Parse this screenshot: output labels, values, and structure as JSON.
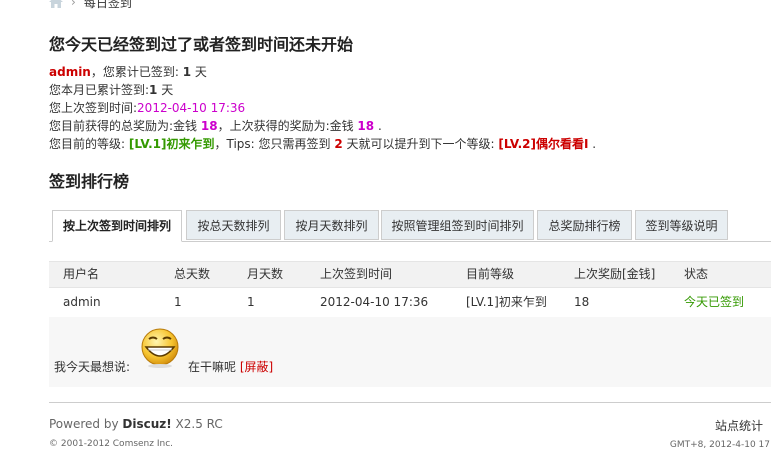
{
  "breadcrumb": {
    "current": "每日签到"
  },
  "page_title": "您今天已经签到过了或者签到时间还未开始",
  "info": {
    "username": "admin",
    "total_prefix": "，您累计已签到: ",
    "total_days": "1",
    "day_unit": " 天",
    "month_prefix": "您本月已累计签到:",
    "month_days": "1",
    "month_unit": " 天",
    "last_prefix": "您上次签到时间:",
    "last_time": "2012-04-10 17:36",
    "reward_prefix": "您目前获得的总奖励为:金钱 ",
    "reward_total": "18",
    "reward_mid": "，上次获得的奖励为:金钱 ",
    "reward_last": "18",
    "reward_end": " .",
    "level_prefix": "您目前的等级: ",
    "level_current": "[LV.1]初来乍到",
    "tips_prefix": "，Tips: 您只需再签到 ",
    "tips_days": "2",
    "tips_mid": " 天就可以提升到下一个等级: ",
    "level_next": "[LV.2]偶尔看看I",
    "tips_end": " ."
  },
  "rank_title": "签到排行榜",
  "tabs": [
    {
      "label": "按上次签到时间排列",
      "active": true
    },
    {
      "label": "按总天数排列"
    },
    {
      "label": "按月天数排列"
    },
    {
      "label": "按照管理组签到时间排列"
    },
    {
      "label": "总奖励排行榜"
    },
    {
      "label": "签到等级说明"
    }
  ],
  "table": {
    "headers": [
      "用户名",
      "总天数",
      "月天数",
      "上次签到时间",
      "目前等级",
      "上次奖励[金钱]",
      "状态"
    ],
    "rows": [
      [
        "admin",
        "1",
        "1",
        "2012-04-10 17:36",
        "[LV.1]初来乍到",
        "18",
        "今天已签到"
      ]
    ]
  },
  "mood": {
    "label": "我今天最想说:",
    "text": "在干嘛呢",
    "shield": "[屏蔽]",
    "icon": "grin-smiley-icon"
  },
  "footer": {
    "powered_prefix": "Powered by ",
    "brand": "Discuz!",
    "version": " X2.5 RC",
    "copyright": "© 2001-2012 Comsenz Inc.",
    "stats": "站点统计",
    "time": "GMT+8, 2012-4-10 17"
  },
  "colors": {
    "red": "#cc0000",
    "pink": "#cc00cc",
    "green": "#339900"
  }
}
